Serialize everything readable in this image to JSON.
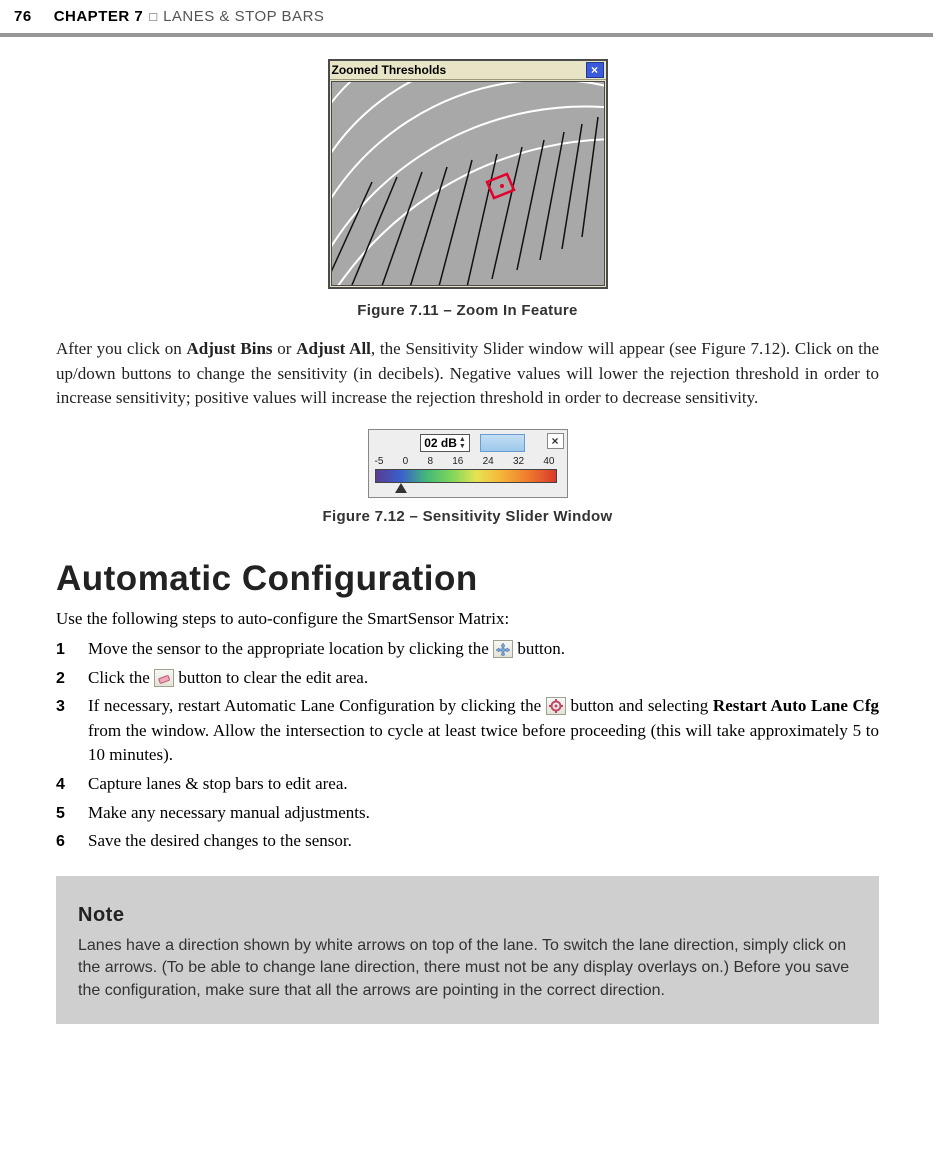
{
  "header": {
    "page_number": "76",
    "chapter_label": "CHAPTER 7",
    "separator": "□",
    "chapter_title": "LANES & STOP BARS"
  },
  "fig1": {
    "window_title": "Zoomed Thresholds",
    "caption": "Figure 7.11 – Zoom In Feature"
  },
  "para1_a": "After you click on ",
  "para1_b": "Adjust Bins",
  "para1_c": " or ",
  "para1_d": "Adjust All",
  "para1_e": ", the Sensitivity Slider window will appear (see Figure 7.12). Click on the up/down buttons to change the sensitivity (in decibels). Negative values will lower the rejection threshold in order to increase sensitivity; positive values will increase the rejection threshold in order to decrease sensitivity.",
  "fig2": {
    "readout": "02 dB",
    "scale": [
      "-5",
      "0",
      "8",
      "16",
      "24",
      "32",
      "40"
    ],
    "caption": "Figure 7.12 – Sensitivity Slider Window"
  },
  "section_heading": "Automatic Configuration",
  "intro": "Use the following steps to auto-configure the SmartSensor Matrix:",
  "steps": {
    "s1_a": "Move the sensor to the appropriate location by clicking the ",
    "s1_b": " button.",
    "s2_a": "Click the ",
    "s2_b": " button to clear the edit area.",
    "s3_a": "If necessary, restart Automatic Lane Configuration by clicking the ",
    "s3_b": " button and selecting ",
    "s3_c": "Restart Auto Lane Cfg",
    "s3_d": " from the window. Allow the intersection to cycle at least twice before proceeding (this will take approximately 5 to 10 minutes).",
    "s4": "Capture lanes & stop bars to edit area.",
    "s5": "Make any necessary manual adjustments.",
    "s6": "Save the desired changes to the sensor."
  },
  "note": {
    "title": "Note",
    "body": "Lanes have a direction shown by white arrows on top of the lane. To switch the lane direction, simply click on the arrows. (To be able to change lane direction, there must not be any display overlays on.) Before you save the configuration, make sure that all the arrows are pointing in the correct direction."
  }
}
